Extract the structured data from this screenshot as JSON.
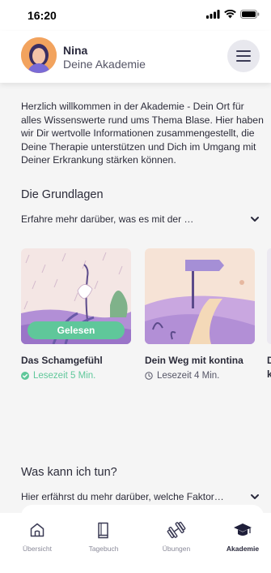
{
  "status_bar": {
    "time": "16:20"
  },
  "header": {
    "name": "Nina",
    "subtitle": "Deine Akademie",
    "menu_icon": "hamburger-icon"
  },
  "intro_text": "Herzlich willkommen in der Akademie - Dein Ort für alles Wissenswerte rund ums Thema Blase. Hier haben wir Dir wertvolle Informationen zusammengestellt, die Deine Therapie unterstützen und Dich im Umgang mit Deiner Erkrankung stärken können.",
  "sections": [
    {
      "title": "Die Grundlagen",
      "subtitle": "Erfahre mehr darüber, was es mit der …"
    },
    {
      "title": "Was kann ich tun?",
      "subtitle": "Hier erfährst du mehr darüber, welche Faktor…"
    }
  ],
  "cards": [
    {
      "title": "Das Schamgefühl",
      "meta": "Lesezeit 5 Min.",
      "badge": "Gelesen",
      "status": "read",
      "meta_color": "#5fc79a"
    },
    {
      "title": "Dein Weg mit kontina",
      "meta": "Lesezeit 4 Min.",
      "status": "unread",
      "meta_color": "#555566"
    },
    {
      "title": "D",
      "title2": "k"
    }
  ],
  "tabs": [
    {
      "label": "Übersicht",
      "icon": "home-icon"
    },
    {
      "label": "Tagebuch",
      "icon": "diary-icon"
    },
    {
      "label": "Übungen",
      "icon": "dumbbell-icon"
    },
    {
      "label": "Akademie",
      "icon": "graduation-cap-icon",
      "active": true
    }
  ],
  "colors": {
    "accent": "#5fc79a",
    "primary": "#2a2a3d",
    "illustration_purple": "#b28fd6"
  }
}
